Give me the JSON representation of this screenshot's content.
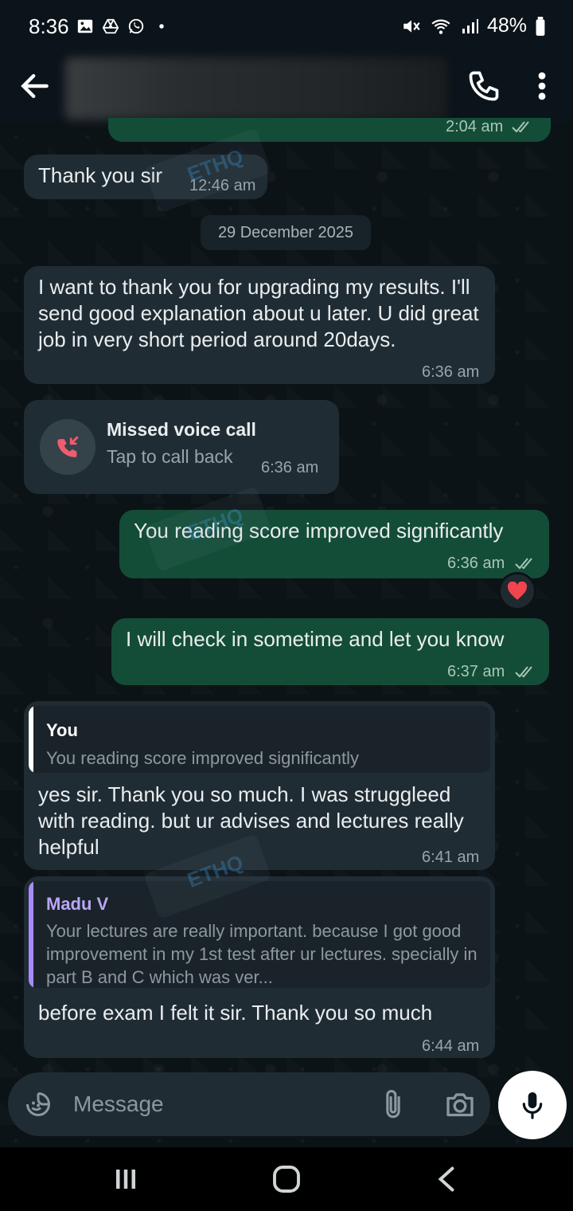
{
  "status_bar": {
    "time": "8:36",
    "battery": "48%",
    "left_icons": [
      "gallery-icon",
      "drive-icon",
      "whatsapp-icon",
      "dot-icon"
    ],
    "right_icons": [
      "mute-icon",
      "wifi-icon",
      "signal-icon",
      "battery-icon"
    ]
  },
  "header": {
    "contact_name": ""
  },
  "partial_top": {
    "time": "2:04 am"
  },
  "messages": [
    {
      "id": "m1",
      "direction": "in",
      "text": "Thank you sir",
      "time": "12:46 am"
    },
    {
      "id": "m2",
      "direction": "in",
      "text": "I want to thank you for upgrading my results. I'll send good explanation about u later. U did great job in very short period around 20days.",
      "time": "6:36 am"
    },
    {
      "id": "m3",
      "direction": "in",
      "type": "missed_call",
      "title": "Missed voice call",
      "subtitle": "Tap to call back",
      "time": "6:36 am"
    },
    {
      "id": "m4",
      "direction": "out",
      "text": "You reading score improved significantly",
      "time": "6:36 am",
      "reaction": "❤️"
    },
    {
      "id": "m5",
      "direction": "out",
      "text": "I will check in sometime and let you know",
      "time": "6:37 am"
    },
    {
      "id": "m6",
      "direction": "in",
      "quote_author": "You",
      "quote_text": "You reading score improved significantly",
      "text": "yes sir. Thank you so much.  I was struggleed with reading. but ur advises and lectures really helpful",
      "time": "6:41 am"
    },
    {
      "id": "m7",
      "direction": "in",
      "quote_author": "Madu V",
      "quote_text": "Your lectures are really important. because I got good improvement in my 1st test after ur lectures. specially in part B and C which was ver...",
      "text": "before exam I felt it sir. Thank you so much",
      "time": "6:44 am"
    }
  ],
  "date_separator": "29 December 2025",
  "watermark": "ETHQ",
  "composer": {
    "placeholder": "Message"
  },
  "colors": {
    "incoming_bubble": "#202c33",
    "outgoing_bubble": "#144d37",
    "read_ticks": "#a7c6b7",
    "missed_call_red": "#f15c6d",
    "quote_bar_you": "#ffffff",
    "quote_bar_madu": "#a78bfa",
    "quote_author_madu": "#b9a6f5"
  }
}
